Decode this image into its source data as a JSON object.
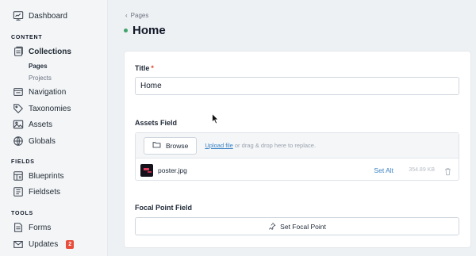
{
  "sidebar": {
    "top_items": [
      {
        "label": "Dashboard",
        "icon": "dashboard-icon"
      }
    ],
    "content_title": "CONTENT",
    "content_items": [
      {
        "label": "Collections",
        "icon": "collections-icon"
      },
      {
        "label": "Navigation",
        "icon": "navigation-icon"
      },
      {
        "label": "Taxonomies",
        "icon": "tag-icon"
      },
      {
        "label": "Assets",
        "icon": "image-icon"
      },
      {
        "label": "Globals",
        "icon": "globe-icon"
      }
    ],
    "collections_sub": [
      {
        "label": "Pages"
      },
      {
        "label": "Projects"
      }
    ],
    "fields_title": "FIELDS",
    "fields_items": [
      {
        "label": "Blueprints",
        "icon": "blueprint-icon"
      },
      {
        "label": "Fieldsets",
        "icon": "fieldset-icon"
      }
    ],
    "tools_title": "TOOLS",
    "tools_items": [
      {
        "label": "Forms",
        "icon": "form-icon"
      },
      {
        "label": "Updates",
        "icon": "updates-icon",
        "badge": "2"
      }
    ]
  },
  "breadcrumb": {
    "label": "Pages"
  },
  "page": {
    "title": "Home",
    "status_color": "#3fa46a"
  },
  "form": {
    "title_field": {
      "label": "Title",
      "required_mark": "*",
      "value": "Home"
    },
    "assets_field": {
      "label": "Assets Field",
      "browse_label": "Browse",
      "upload_link": "Upload file",
      "drop_hint": "or drag & drop here to replace.",
      "asset": {
        "name": "poster.jpg",
        "set_alt": "Set Alt",
        "size": "354.89 KB"
      }
    },
    "focal_field": {
      "label": "Focal Point Field",
      "button_label": "Set Focal Point"
    }
  },
  "colors": {
    "accent": "#3b82c4",
    "badge": "#e94e3c",
    "required": "#e0462a"
  }
}
